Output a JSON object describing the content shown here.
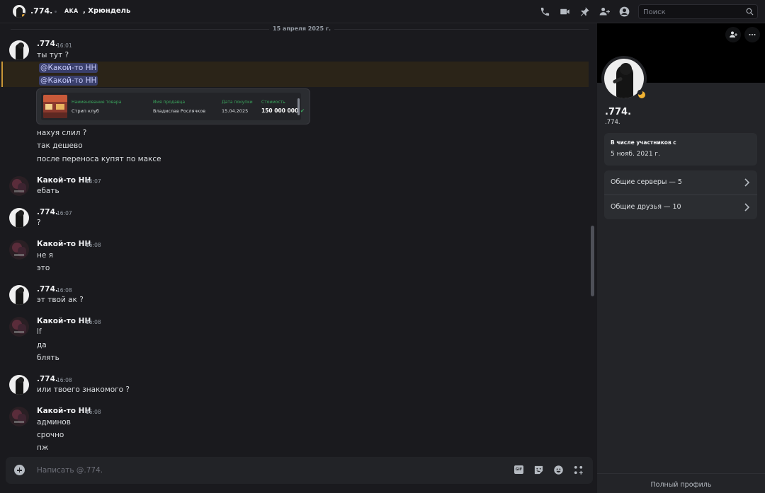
{
  "header": {
    "dm_name": ".774.",
    "tag": "AKA",
    "tag_name": ", Хрюндель",
    "icons": [
      "phone-icon",
      "video-icon",
      "pin-icon",
      "add-member-icon",
      "user-profile-icon"
    ],
    "search_placeholder": "Поиск"
  },
  "chat": {
    "date_divider": "15 апреля 2025 г.",
    "groups": [
      {
        "author": ".774.",
        "time": "16:01",
        "lines": [
          "ты тут ?"
        ]
      },
      {
        "mentions": [
          "@Какой-то НН",
          "@Какой-то НН"
        ]
      },
      {
        "lines": [
          "нахуя слил ?",
          "так дешево",
          "после переноса купят по максе"
        ]
      },
      {
        "author": "Какой-то НН",
        "time": "16:07",
        "lines": [
          "ебать"
        ]
      },
      {
        "author": ".774.",
        "time": "16:07",
        "lines": [
          "?"
        ]
      },
      {
        "author": "Какой-то НН",
        "time": "16:08",
        "lines": [
          "не я",
          "это"
        ]
      },
      {
        "author": ".774.",
        "time": "16:08",
        "lines": [
          "эт твой ак ?"
        ]
      },
      {
        "author": "Какой-то НН",
        "time": "16:08",
        "lines": [
          "lf",
          "да",
          "блять"
        ]
      },
      {
        "author": ".774.",
        "time": "16:08",
        "lines": [
          "или твоего знакомого ?"
        ]
      },
      {
        "author": "Какой-то НН",
        "time": "16:08",
        "lines": [
          "админов",
          "срочно",
          "пж"
        ]
      }
    ],
    "embed": {
      "headers": [
        "Наименование товара",
        "Имя продавца",
        "Дата покупки",
        "Стоимость"
      ],
      "values": [
        "Стрип клуб",
        "Владислав Рослячков",
        "15.04.2025",
        "150 000 000"
      ]
    }
  },
  "composer": {
    "placeholder": "Написать @.774.",
    "gif_label": "GIF"
  },
  "profile": {
    "display_name": ".774.",
    "username": ".774.",
    "member_since_title": "В числе участников с",
    "member_since_value": "5 нояб. 2021 г.",
    "mutual_servers": "Общие серверы — 5",
    "mutual_friends": "Общие друзья — 10",
    "full_profile": "Полный профиль"
  },
  "colors": {
    "background": "#1a1a1e",
    "panel": "#232428",
    "mention_bg": "#3a3f6c",
    "mention_highlight": "#2b2418",
    "status_idle": "#f0b232",
    "embed_header_green": "#3ba55d"
  }
}
